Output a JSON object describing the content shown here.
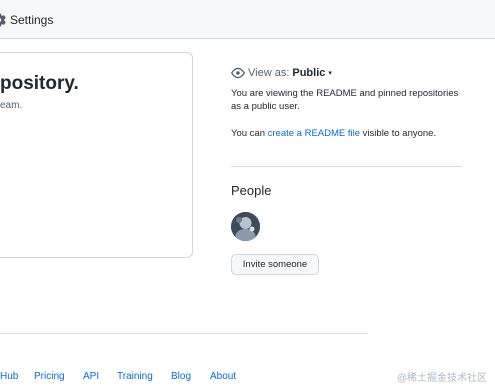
{
  "topbar": {
    "settings_label": "Settings",
    "settings_icon": "gear-icon"
  },
  "card": {
    "title": "pository.",
    "subtitle": "eam."
  },
  "sidebar": {
    "view_as": {
      "icon": "eye-icon",
      "label": "View as:",
      "value": "Public",
      "caret": "▾"
    },
    "view_description": "You are viewing the README and pinned repositories as a public user.",
    "readme": {
      "prefix": "You can ",
      "link": "create a README file",
      "suffix": " visible to anyone."
    },
    "people": {
      "title": "People",
      "invite_button": "Invite someone"
    }
  },
  "footer": {
    "links": [
      "Hub",
      "Pricing",
      "API",
      "Training",
      "Blog",
      "About"
    ]
  },
  "watermark": "@稀土掘金技术社区",
  "colors": {
    "link": "#0969da",
    "text": "#24292f",
    "muted": "#57606a",
    "border": "#d0d7de",
    "topbar_bg": "#f6f8fa"
  }
}
